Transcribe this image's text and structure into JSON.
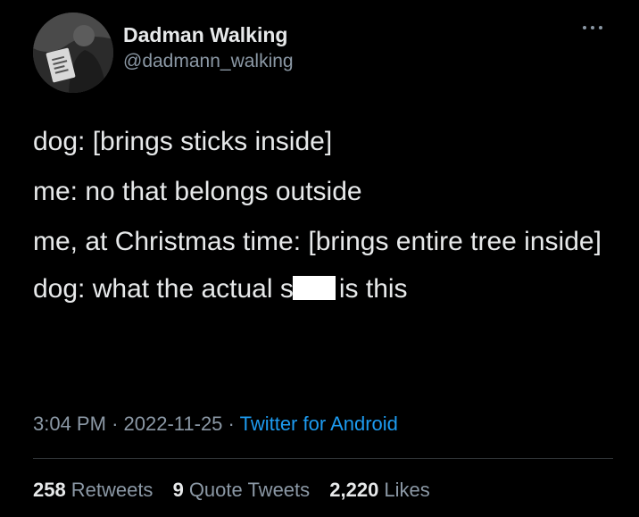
{
  "author": {
    "display_name": "Dadman Walking",
    "handle": "@dadmann_walking",
    "avatar_icon": "profile-photo"
  },
  "tweet": {
    "lines": [
      "dog: [brings sticks inside]",
      "me: no that belongs outside",
      "me, at Christmas time: [brings entire tree inside]"
    ],
    "last_line_before": "dog: what the actual s",
    "last_line_after": "is this",
    "censored_color": "#ffffff"
  },
  "meta": {
    "time": "3:04 PM",
    "separator": "·",
    "date": "2022-11-25",
    "source": "Twitter for Android"
  },
  "stats": {
    "retweets_count": "258",
    "retweets_label": "Retweets",
    "quotes_count": "9",
    "quotes_label": "Quote Tweets",
    "likes_count": "2,220",
    "likes_label": "Likes"
  },
  "colors": {
    "background": "#000000",
    "primary_text": "#e7e9ea",
    "secondary_text": "#8b98a5",
    "link": "#1d9bf0"
  }
}
